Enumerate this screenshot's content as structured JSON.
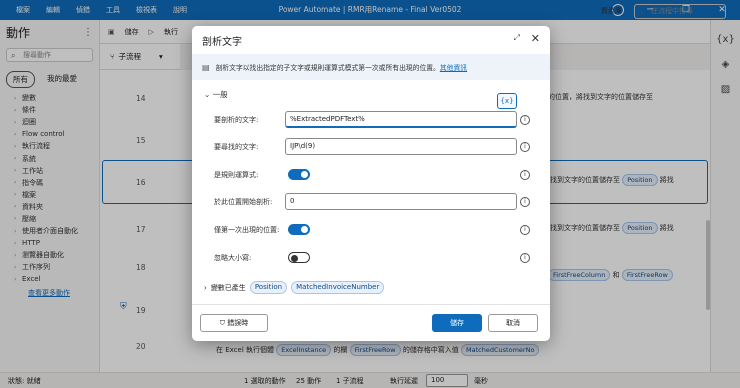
{
  "titlebar": {
    "menu": [
      "檔案",
      "編輯",
      "偵錯",
      "工具",
      "檢視表",
      "說明"
    ],
    "title": "Power Automate | RMR用Rename - Final Ver0502"
  },
  "sidebar": {
    "title": "動作",
    "search_placeholder": "搜尋動作",
    "tabs": [
      "所有",
      "我的最愛"
    ],
    "items": [
      "變數",
      "條件",
      "迴圈",
      "Flow control",
      "執行流程",
      "系統",
      "工作站",
      "指令碼",
      "檔案",
      "資料夾",
      "壓縮",
      "使用者介面自動化",
      "HTTP",
      "瀏覽器自動化",
      "工作序列",
      "Excel"
    ],
    "more": "查看更多動作"
  },
  "toolbar": {
    "save": "儲存",
    "run": "執行",
    "assets": "資產庫",
    "search_placeholder": "在流程中搜尋"
  },
  "subflow": {
    "label": "子流程"
  },
  "canvas": {
    "row_numbers": [
      "14",
      "15",
      "16",
      "17",
      "18",
      "19",
      "20"
    ],
    "row14_text": "的位置，將找到文字的位置儲存至",
    "row16_text": "找到文字的位置儲存至",
    "row16_chip": "Position",
    "row16_tail": "將找",
    "row17_text": "找到文字的位置儲存至",
    "row17_chip": "Position",
    "row17_tail": "將找",
    "row18_chip1": "FirstFreeColumn",
    "row18_and": "和",
    "row18_chip2": "FirstFreeRow",
    "bottom_prefix": "在 Excel 執行個體",
    "bottom_chip1": "ExcelInstance",
    "bottom_mid": "的欄",
    "bottom_chip2": "FirstFreeRow",
    "bottom_mid2": "的儲存格中寫入值",
    "bottom_chip3": "MatchedCustomerNo"
  },
  "statusbar": {
    "state": "狀態: 就緒",
    "selected": "1 選取的動作",
    "actions": "25 動作",
    "subflows": "1 子流程",
    "delay_label": "執行延遲",
    "delay_value": "100",
    "delay_unit": "毫秒"
  },
  "dialog": {
    "title": "剖析文字",
    "info": "剖析文字以找出指定的子文字或規則運算式模式第一次或所有出現的位置。",
    "info_link": "其他資訊",
    "section": "一般",
    "var_button": "{x}",
    "fields": [
      {
        "label": "要剖析的文字:",
        "value": "%ExtractedPDFText%"
      },
      {
        "label": "要尋找的文字:",
        "value": "IJP\\d(9)"
      },
      {
        "label": "是規則運算式:"
      },
      {
        "label": "於此位置開始剖析:",
        "value": "0"
      },
      {
        "label": "僅第一次出現的位置:"
      },
      {
        "label": "忽略大小寫:"
      }
    ],
    "toggles": {
      "regex": true,
      "first_only": true,
      "ignore_case": false
    },
    "vars_label": "變數已產生",
    "vars": [
      "Position",
      "MatchedInvoiceNumber"
    ],
    "on_error": "錯誤時",
    "save": "儲存",
    "cancel": "取消"
  }
}
